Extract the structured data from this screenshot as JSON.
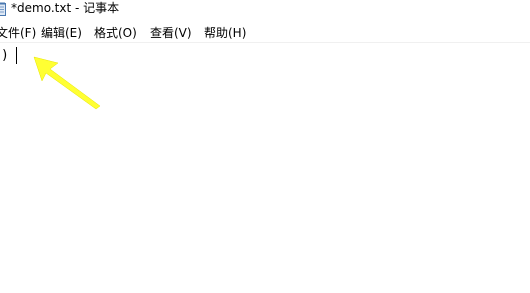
{
  "window": {
    "title": "*demo.txt - 记事本"
  },
  "menu": {
    "file": "文件(F)",
    "edit": "编辑(E)",
    "format": "格式(O)",
    "view": "查看(V)",
    "help": "帮助(H)"
  },
  "editor": {
    "content": ")"
  },
  "icons": {
    "app": "notepad-icon",
    "annotation": "arrow-annotation-icon"
  },
  "colors": {
    "arrow": "#ffff33",
    "background": "#ffffff",
    "text": "#000000"
  }
}
